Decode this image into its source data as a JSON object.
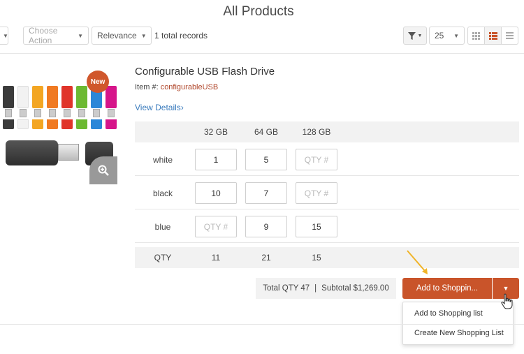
{
  "page": {
    "title": "All Products"
  },
  "toolbar": {
    "choose_action": "Choose Action",
    "sort": "Relevance",
    "total_records": "1 total records",
    "per_page": "25"
  },
  "product": {
    "name": "Configurable USB Flash Drive",
    "item_label": "Item #:",
    "sku": "configurableUSB",
    "view_details": "View Details",
    "badge": "New"
  },
  "matrix": {
    "columns": [
      "32 GB",
      "64 GB",
      "128 GB"
    ],
    "rows": [
      {
        "label": "white",
        "values": [
          "1",
          "5",
          ""
        ]
      },
      {
        "label": "black",
        "values": [
          "10",
          "7",
          ""
        ]
      },
      {
        "label": "blue",
        "values": [
          "",
          "9",
          "15"
        ]
      }
    ],
    "qty_placeholder": "QTY #",
    "qty_label": "QTY",
    "qty_totals": [
      "11",
      "21",
      "15"
    ]
  },
  "totals": {
    "total_qty": "Total QTY 47",
    "separator": "|",
    "subtotal": "Subtotal $1,269.00"
  },
  "actions": {
    "add_button": "Add to Shoppin...",
    "menu": [
      "Add to Shopping list",
      "Create New Shopping List"
    ]
  },
  "colors": {
    "accent": "#c9542a",
    "badge": "#d0572c",
    "link": "#3a7bbd",
    "sku": "#b0462a",
    "arrow": "#f0b429"
  },
  "swatches": [
    "#3b3b3b",
    "#f2f2f2",
    "#f3a623",
    "#f07a22",
    "#e0342a",
    "#6cb932",
    "#2b87d8",
    "#d6158a"
  ]
}
